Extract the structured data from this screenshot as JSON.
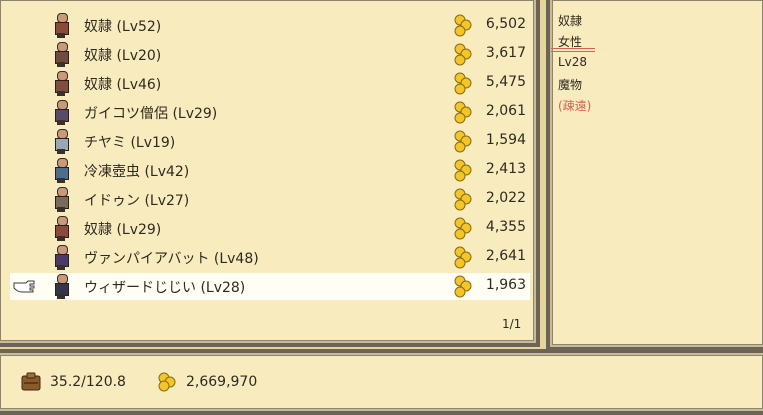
{
  "shop_list": {
    "items": [
      {
        "name": "奴隷 (Lv52)",
        "price": "6,502",
        "sprite_color": "#8a4b3a"
      },
      {
        "name": "奴隷 (Lv20)",
        "price": "3,617",
        "sprite_color": "#6f4b3e"
      },
      {
        "name": "奴隷 (Lv46)",
        "price": "5,475",
        "sprite_color": "#7d503e"
      },
      {
        "name": "ガイコツ僧侶 (Lv29)",
        "price": "2,061",
        "sprite_color": "#5a4a6a"
      },
      {
        "name": "チヤミ (Lv19)",
        "price": "1,594",
        "sprite_color": "#9aa7b5"
      },
      {
        "name": "冷凍壺虫 (Lv42)",
        "price": "2,413",
        "sprite_color": "#4c6d8c"
      },
      {
        "name": "イドゥン (Lv27)",
        "price": "2,022",
        "sprite_color": "#7a6a5a"
      },
      {
        "name": "奴隷 (Lv29)",
        "price": "4,355",
        "sprite_color": "#8a4b3a"
      },
      {
        "name": "ヴァンパイアバット (Lv48)",
        "price": "2,641",
        "sprite_color": "#4a3b6a"
      },
      {
        "name": "ウィザードじじい (Lv28)",
        "price": "1,963",
        "sprite_color": "#34374a",
        "selected": true
      }
    ],
    "page_indicator": "1/1"
  },
  "info_panel": {
    "lines": [
      "奴隷",
      "女性",
      "Lv28",
      "魔物",
      "(疎遠)"
    ],
    "accent_color": "#d8605a"
  },
  "status_bar": {
    "weight": "35.2/120.8",
    "gold": "2,669,970"
  }
}
